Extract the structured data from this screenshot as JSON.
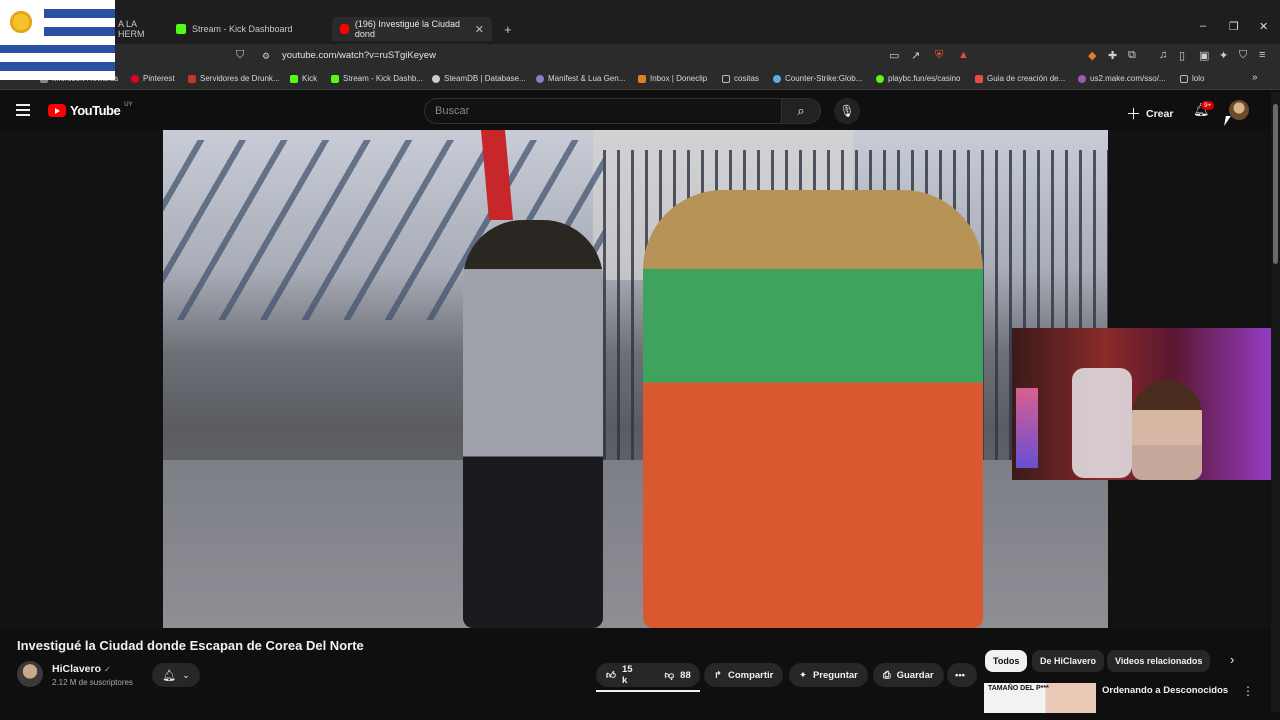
{
  "browser": {
    "tabs": [
      {
        "label": "A LA HERM",
        "active": false
      },
      {
        "label": "Stream - Kick Dashboard",
        "active": false
      },
      {
        "label": "(196) Investigué la Ciudad dond",
        "active": true
      }
    ],
    "new_tab": "+",
    "window_controls": {
      "minimize": "–",
      "restore": "❐",
      "close": "✕"
    },
    "url": "youtube.com/watch?v=ruSTgiKeyew",
    "bookmarks": [
      {
        "label": "Microsoft Rewards",
        "color": "#888888"
      },
      {
        "label": "Pinterest",
        "color": "#e60023"
      },
      {
        "label": "Servidores de Drunk...",
        "color": "#c0392b"
      },
      {
        "label": "Kick",
        "color": "#53fc18"
      },
      {
        "label": "Stream - Kick Dashb...",
        "color": "#53fc18"
      },
      {
        "label": "SteamDB | Database...",
        "color": "#cccccc"
      },
      {
        "label": "Manifest & Lua Gen...",
        "color": "#8e7cc3"
      },
      {
        "label": "Inbox | Doneclip",
        "color": "#e67e22"
      },
      {
        "label": "cositas",
        "color": "#bbbbbb"
      },
      {
        "label": "Counter-Strike:Glob...",
        "color": "#5dade2"
      },
      {
        "label": "playbc.fun/es/casino",
        "color": "#53fc18"
      },
      {
        "label": "Guia de creación de...",
        "color": "#e74c3c"
      },
      {
        "label": "us2.make.com/sso/...",
        "color": "#9b59b6"
      },
      {
        "label": "lolo",
        "color": "#bbbbbb"
      }
    ]
  },
  "youtube": {
    "logo_text": "YouTube",
    "country_code": "UY",
    "search_placeholder": "Buscar",
    "create_label": "Crear",
    "notification_badge": "9+"
  },
  "video": {
    "title": "Investigué la Ciudad donde Escapan de Corea Del Norte",
    "channel_name": "HiClavero",
    "subscribers": "2.12 M de suscriptores",
    "likes": "15 k",
    "dislikes": "88",
    "share_label": "Compartir",
    "ask_label": "Preguntar",
    "save_label": "Guardar",
    "more_label": "•••"
  },
  "sidebar": {
    "chips": [
      "Todos",
      "De HiClavero",
      "Videos relacionados"
    ],
    "active_chip": "Todos",
    "recommended": [
      {
        "thumb_text": "TAMAÑO DEL P***",
        "title": "Ordenando a Desconocidos"
      }
    ]
  },
  "colors": {
    "yt_red": "#ff0000",
    "background": "#0f0f0f",
    "pill_bg": "#272727",
    "badge_red": "#cc0000"
  }
}
